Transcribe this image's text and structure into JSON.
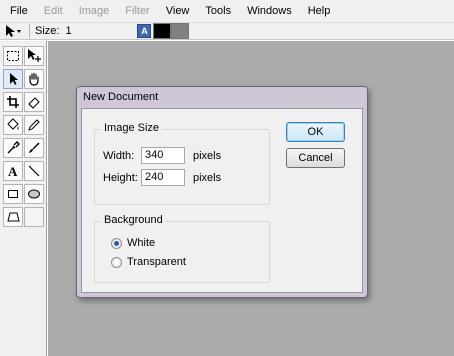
{
  "menu": {
    "items": [
      {
        "label": "File",
        "disabled": false
      },
      {
        "label": "Edit",
        "disabled": true
      },
      {
        "label": "Image",
        "disabled": true
      },
      {
        "label": "Filter",
        "disabled": true
      },
      {
        "label": "View",
        "disabled": false
      },
      {
        "label": "Tools",
        "disabled": false
      },
      {
        "label": "Windows",
        "disabled": false
      },
      {
        "label": "Help",
        "disabled": false
      }
    ]
  },
  "toolbar": {
    "size_label": "Size:",
    "size_value": "1",
    "text_icon_glyph": "A",
    "primary_color": "#000000",
    "secondary_color": "#808080"
  },
  "tools": [
    "rect-select-icon",
    "move-selection-icon",
    "pointer-icon",
    "hand-icon",
    "crop-icon",
    "eraser-icon",
    "paint-bucket-icon",
    "pencil-icon",
    "eyedropper-icon",
    "brush-icon",
    "text-icon",
    "line-icon",
    "rectangle-icon",
    "ellipse-icon",
    "polygon-icon"
  ],
  "dialog": {
    "title": "New Document",
    "image_size": {
      "legend": "Image Size",
      "width_label": "Width:",
      "width_value": "340",
      "height_label": "Height:",
      "height_value": "240",
      "unit": "pixels"
    },
    "background": {
      "legend": "Background",
      "options": [
        {
          "label": "White",
          "selected": true
        },
        {
          "label": "Transparent",
          "selected": false
        }
      ]
    },
    "ok_label": "OK",
    "cancel_label": "Cancel"
  }
}
